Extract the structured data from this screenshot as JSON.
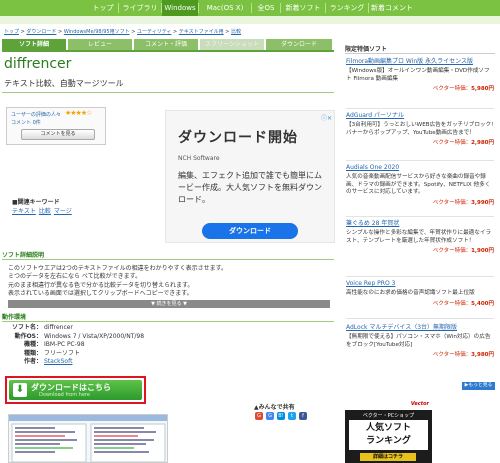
{
  "nav": {
    "items": [
      "トップ",
      "ライブラリ",
      "Windows",
      "Mac(OS X)",
      "全OS",
      "新着ソフト",
      "ランキング",
      "新着コメント"
    ],
    "active_index": 2
  },
  "breadcrumb": {
    "items": [
      "トップ",
      "ダウンロード",
      "WindowsMe/98/95用ソフト",
      "ユーティリティ",
      "テキストファイル用",
      "比較"
    ],
    "separator": ">"
  },
  "tabs": [
    "ソフト詳細",
    "レビュー",
    "コメント・評価",
    "スクリーンショット",
    "ダウンロード"
  ],
  "app": {
    "name": "diffrencer",
    "subtitle": "テキスト比較、自動マージツール"
  },
  "rating": {
    "label": "ユーザーの評価の人々",
    "stars": "★★★★☆",
    "comments_label": "コメント 0件",
    "comments_button": "コメントを見る"
  },
  "ad": {
    "title": "ダウンロード開始",
    "vendor": "NCH Software",
    "body": "編集、エフェクト追加で誰でも簡単にムービー作成。大人気ソフトを無料ダウンロード。",
    "button": "ダウンロード",
    "info_icon": "info-icon"
  },
  "keywords": {
    "label": "■関連キーワード",
    "items": [
      "テキスト",
      "比較",
      "マージ"
    ]
  },
  "description": {
    "heading": "ソフト詳細説明",
    "lines": [
      "このソフトウエアは2つのテキストファイルの相違をわかりやすく表示させます。",
      "ミつのデータを左右になら べて比較ができます。",
      "元のまま相違行が異なる色で分かる比較データを切り替えられます。",
      "表示されている画面では選択してクリップボードへコピーできます。"
    ],
    "more": "▼ 続きを見る ▼"
  },
  "environment": {
    "heading": "動作環境",
    "rows": [
      {
        "k": "ソフト名：",
        "v": "diffrencer",
        "link": false
      },
      {
        "k": "動作OS：",
        "v": "Windows 7 / Vista/XP/2000/NT/98",
        "link": false
      },
      {
        "k": "機種：",
        "v": "IBM-PC PC-98",
        "link": false
      },
      {
        "k": "種類：",
        "v": "フリーソフト",
        "link": false
      },
      {
        "k": "作者：",
        "v": "StackSoft",
        "link": true
      }
    ]
  },
  "download_button": {
    "label": "ダウンロードはこちら",
    "sub": "Download from here"
  },
  "share": {
    "label": "▲みんなで共有",
    "icons": [
      "google-plus-icon",
      "google-icon",
      "hatena-icon",
      "twitter-icon",
      "facebook-icon"
    ]
  },
  "sidebar": {
    "title": "限定特価ソフト",
    "items": [
      {
        "title": "Filmora動画編集プロ Win版 永久ライセンス版",
        "desc": "【Windows版】オールインワン動画編集・DVD作成ソフト Filmora 動画編集",
        "price_label": "ベクター特価：",
        "price": "5,980円"
      },
      {
        "title": "AdGuard パーソナル",
        "desc": "【3台利用可】うっとおしいWEB広告をガッチリブロック! バナーからポップアップ、YouTube動画広告まで！",
        "price_label": "ベクター特価：",
        "price": "2,980円"
      },
      {
        "title": "Audials One 2020",
        "desc": "人気の音楽動画配信サービスから好きな楽曲の録音や録画、ドラマの録画ができます。Spotify、NETFLIX 他多くのサービスに対応しています。",
        "price_label": "ベクター特価：",
        "price": "3,990円"
      },
      {
        "title": "筆ぐるめ 28 年賀状",
        "desc": "シンプルな操作と多彩な編集で、年賀状作りに最適なイラスト、テンプレートを厳選した年賀状作成ソフト！",
        "price_label": "ベクター特価：",
        "price": "1,900円"
      },
      {
        "title": "Voice Rep PRO 3",
        "desc": "高性能なのにお求め価格の音声認識ソフト最上位版",
        "price_label": "ベクター特価：",
        "price": "5,400円"
      },
      {
        "title": "AdLock マルチデバイス（3台）無期限版",
        "desc": "【無期限で使える】パソコン・スマホ（Win対応）の広告をブロック[YouTube対応]",
        "price_label": "ベクター特価：",
        "price": "3,980円"
      }
    ],
    "more": "▶もっと見る"
  },
  "banner": {
    "top": "Vector",
    "sub": "ベクター・PCショップ",
    "main_line1": "人気ソフト",
    "main_line2": "ランキング",
    "cta": "詳細はコチラ"
  },
  "colors": {
    "nav_bg": "#7cc242",
    "accent_green": "#2a7d1c",
    "link": "#2566b0",
    "price": "#cc2200",
    "download_border": "#e0141e"
  }
}
